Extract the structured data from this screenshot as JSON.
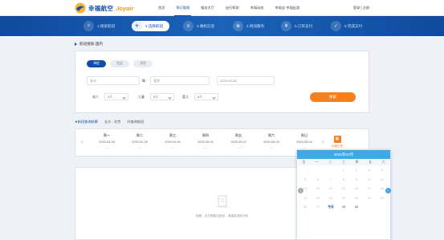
{
  "header": {
    "brand_cn": "幸福航空",
    "brand_en": "Joyair",
    "nav": [
      "首页",
      "预订管理",
      "服务大厅",
      "出行帮助",
      "幸福动态",
      "幸福会·幸福出游"
    ],
    "active_nav": 1,
    "user_link": "登录 | 注册"
  },
  "steps": [
    {
      "num": "1",
      "label": "1.搜索航班",
      "icon": "search-icon"
    },
    {
      "num": "2",
      "label": "2.选择航班",
      "icon": "plane-icon"
    },
    {
      "num": "3",
      "label": "3.乘机信息",
      "icon": "list-icon"
    },
    {
      "num": "4",
      "label": "4.附加服务",
      "icon": "cart-icon"
    },
    {
      "num": "5",
      "label": "5.订单支付",
      "icon": "yen-icon"
    },
    {
      "num": "6",
      "label": "6.完成支付",
      "icon": "check-icon"
    }
  ],
  "breadcrumb": "航班搜索-国内",
  "search": {
    "trip_types": [
      "单程",
      "往返",
      "多程"
    ],
    "from_placeholder": "长沙",
    "swap": "⇆",
    "to_value": "北京",
    "date_value": "2020-04-28",
    "adult_label": "成人",
    "adult_value": "1人",
    "child_label": "儿童",
    "child_value": "0人",
    "infant_label": "婴儿",
    "infant_value": "0人",
    "search_button": "搜索"
  },
  "filter": {
    "title": "★航班查询结果",
    "route": "长沙 - 北京",
    "date": "共查询航班"
  },
  "datebar": {
    "days": [
      {
        "week": "周一",
        "date": "2020-04-28",
        "price": "---"
      },
      {
        "week": "周二",
        "date": "2020-04-29",
        "price": "---"
      },
      {
        "week": "周三",
        "date": "2020-04-30",
        "price": "---"
      },
      {
        "week": "周四",
        "date": "2020-05-01",
        "price": "---"
      },
      {
        "week": "周五",
        "date": "2020-05-02",
        "price": "---"
      },
      {
        "week": "周六",
        "date": "2020-05-03",
        "price": "---"
      },
      {
        "week": "周日",
        "date": "2020-05-04",
        "price": "---"
      }
    ],
    "calendar_label": "价格日历"
  },
  "empty_text": "抱歉，该日期暂无航班，请重新选择日期",
  "calendar": {
    "title": "2020年04月",
    "weekdays": [
      "日",
      "一",
      "二",
      "三",
      "四",
      "五",
      "六"
    ],
    "cells": [
      "",
      "",
      "",
      "1",
      "2",
      "3",
      "4",
      "5",
      "6",
      "7",
      "8",
      "9",
      "10",
      "11",
      "12",
      "13",
      "14",
      "15",
      "16",
      "17",
      "18",
      "19",
      "20",
      "21",
      "22",
      "23",
      "24",
      "25",
      "26",
      "27",
      "今天",
      "29",
      "30",
      "",
      ""
    ],
    "nav_prev": "‹",
    "nav_next": "›",
    "colors": {
      "header": "#3fa9e6",
      "prev": "#aaaaaa",
      "next": "#3fa9e6"
    }
  },
  "colors": {
    "brand": "#0f4fa8",
    "accent": "#f5801d"
  }
}
